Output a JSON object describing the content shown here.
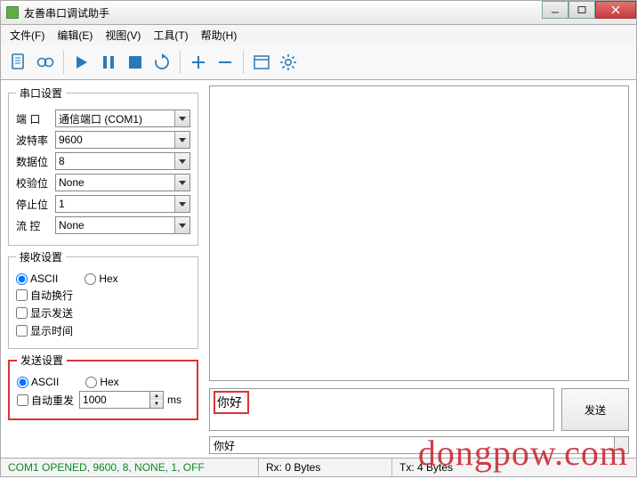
{
  "window": {
    "title": "友善串口调试助手"
  },
  "menu": {
    "file": "文件(F)",
    "edit": "编辑(E)",
    "view": "视图(V)",
    "tools": "工具(T)",
    "help": "帮助(H)"
  },
  "toolbar_icons": [
    "new",
    "record",
    "play",
    "pause",
    "stop",
    "refresh",
    "plus",
    "minus",
    "window",
    "gear"
  ],
  "serial": {
    "legend": "串口设置",
    "port_label": "端 口",
    "port": "通信端口 (COM1)",
    "baud_label": "波特率",
    "baud": "9600",
    "data_label": "数据位",
    "data": "8",
    "parity_label": "校验位",
    "parity": "None",
    "stop_label": "停止位",
    "stop": "1",
    "flow_label": "流 控",
    "flow": "None"
  },
  "recv": {
    "legend": "接收设置",
    "ascii": "ASCII",
    "hex": "Hex",
    "autowrap": "自动换行",
    "showsend": "显示发送",
    "showtime": "显示时间"
  },
  "send": {
    "legend": "发送设置",
    "ascii": "ASCII",
    "hex": "Hex",
    "autorepeat": "自动重发",
    "interval": "1000",
    "unit": "ms"
  },
  "tx": {
    "input": "你好",
    "button": "发送",
    "echo": "你好"
  },
  "status": {
    "conn": "COM1 OPENED, 9600, 8, NONE, 1, OFF",
    "rx": "Rx: 0 Bytes",
    "tx": "Tx: 4 Bytes"
  },
  "watermark": "dongpow.com"
}
